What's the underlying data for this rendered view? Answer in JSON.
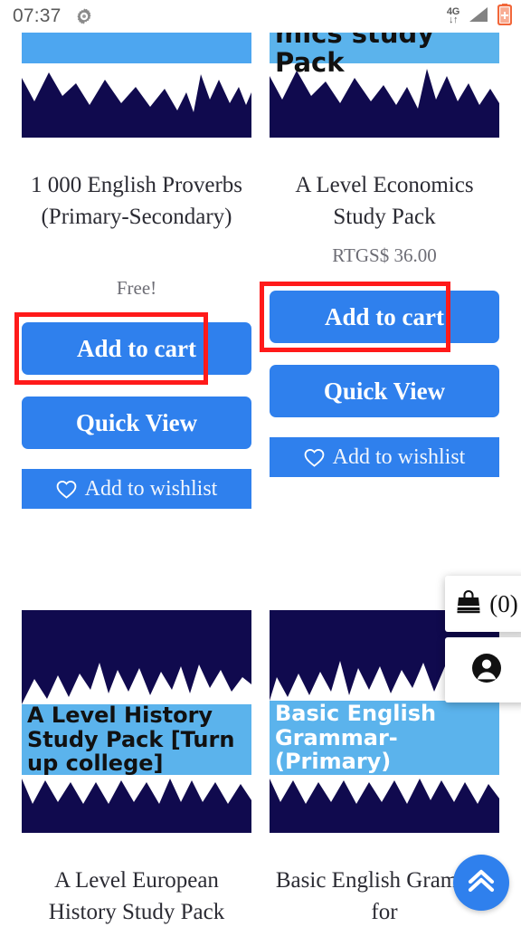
{
  "status_bar": {
    "time": "07:37",
    "gear_icon": "gear-icon",
    "network_label": "4G",
    "network_arrows": "↓↑",
    "signal_icon": "signal-triangle-icon",
    "battery_icon": "battery-charging-icon"
  },
  "colors": {
    "button_blue": "#2f80ed",
    "thumb_navy": "#100a4e",
    "thumb_band_blue": "#4da6f0",
    "thumb_band_blue_light": "#5bb3ec",
    "annotation_red": "#ff1a1a",
    "title_text": "#2b2b33",
    "price_text": "#6d6d75"
  },
  "products": [
    {
      "id": "english-proverbs",
      "thumb_band_text": "",
      "thumb_band_text_color": "#111111",
      "title": "1 000 English Proverbs (Primary-Secondary)",
      "price": "Free!",
      "add_to_cart_label": "Add to cart",
      "quick_view_label": "Quick View",
      "wishlist_label": "Add to wishlist",
      "highlighted": true
    },
    {
      "id": "a-level-economics",
      "thumb_band_text": "mics study Pack",
      "thumb_band_text_color": "#111111",
      "title": "A Level Economics Study Pack",
      "price": "RTGS$ 36.00",
      "add_to_cart_label": "Add to cart",
      "quick_view_label": "Quick View",
      "wishlist_label": "Add to wishlist",
      "highlighted": true
    },
    {
      "id": "a-level-european-history",
      "thumb_band_text": "A Level History Study Pack [Turn up college]",
      "thumb_band_text_color": "#111111",
      "title": "A Level European History Study Pack",
      "price": "",
      "add_to_cart_label": "",
      "quick_view_label": "",
      "wishlist_label": "",
      "highlighted": false
    },
    {
      "id": "basic-english-grammar",
      "thumb_band_text": "Basic English Grammar-(Primary)",
      "thumb_band_text_color": "#ffffff",
      "title": "Basic English Grammar for",
      "price": "",
      "add_to_cart_label": "",
      "quick_view_label": "",
      "wishlist_label": "",
      "highlighted": false
    }
  ],
  "floating": {
    "cart_icon": "shopping-bag-icon",
    "cart_count": "(0)",
    "account_icon": "account-circle-icon",
    "scroll_top_icon": "double-chevron-up-icon"
  }
}
